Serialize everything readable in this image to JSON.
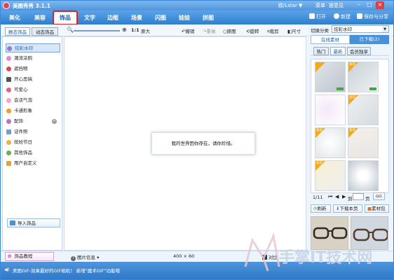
{
  "app": {
    "title": "美图秀秀 3.1.1",
    "user": "欧/Lstar ▼",
    "menu": "菜单",
    "feedback": "提意见"
  },
  "nav": {
    "tabs": [
      "美化",
      "美容",
      "饰品",
      "文字",
      "边框",
      "场景",
      "闪图",
      "娃娃",
      "拼图"
    ],
    "active": "饰品",
    "open": "打开",
    "new": "新建",
    "save": "保存与分享"
  },
  "toolbar": {
    "sub_tabs": [
      "静态饰品",
      "动态饰品"
    ],
    "ratio": "1:1",
    "original_size": "原大",
    "undo": "撤销",
    "redo": "重做",
    "original": "原图",
    "rotate": "旋转",
    "crop": "裁剪",
    "resize": "尺寸"
  },
  "sidebar": {
    "categories": [
      "炫彩水印",
      "潮流涂鸦",
      "遮挡物",
      "开心恶搞",
      "可爱心",
      "会话气泡",
      "卡通形象",
      "配饰",
      "证件照",
      "缤纷节日",
      "其他饰品",
      "用户自定义"
    ],
    "import": "导入饰品",
    "tutorial": "饰品教程"
  },
  "canvas": {
    "notice": "我的世界因你存在，请你珍惜。"
  },
  "status": {
    "info": "图片信息 ▾",
    "size": "400 × 60",
    "compare": "对比"
  },
  "right": {
    "switch_label": "切换分类",
    "category": "炫彩水印",
    "tabs": [
      "在线素材",
      "已下载(2)"
    ],
    "sub_tabs": [
      "热门",
      "最新",
      "会员独享"
    ],
    "tag": "会员",
    "new_badge": "NEW",
    "page": "1/11",
    "goto": "到",
    "page_unit": "页",
    "go": "GO",
    "refresh": "刷新",
    "download_page": "下载本页",
    "library": "素材包"
  },
  "footer": {
    "tip": "美图GIF-效果最好的GIF相机！ 新增\"魔术GIF\"功能哦"
  },
  "watermark": "手掌IT技术网"
}
